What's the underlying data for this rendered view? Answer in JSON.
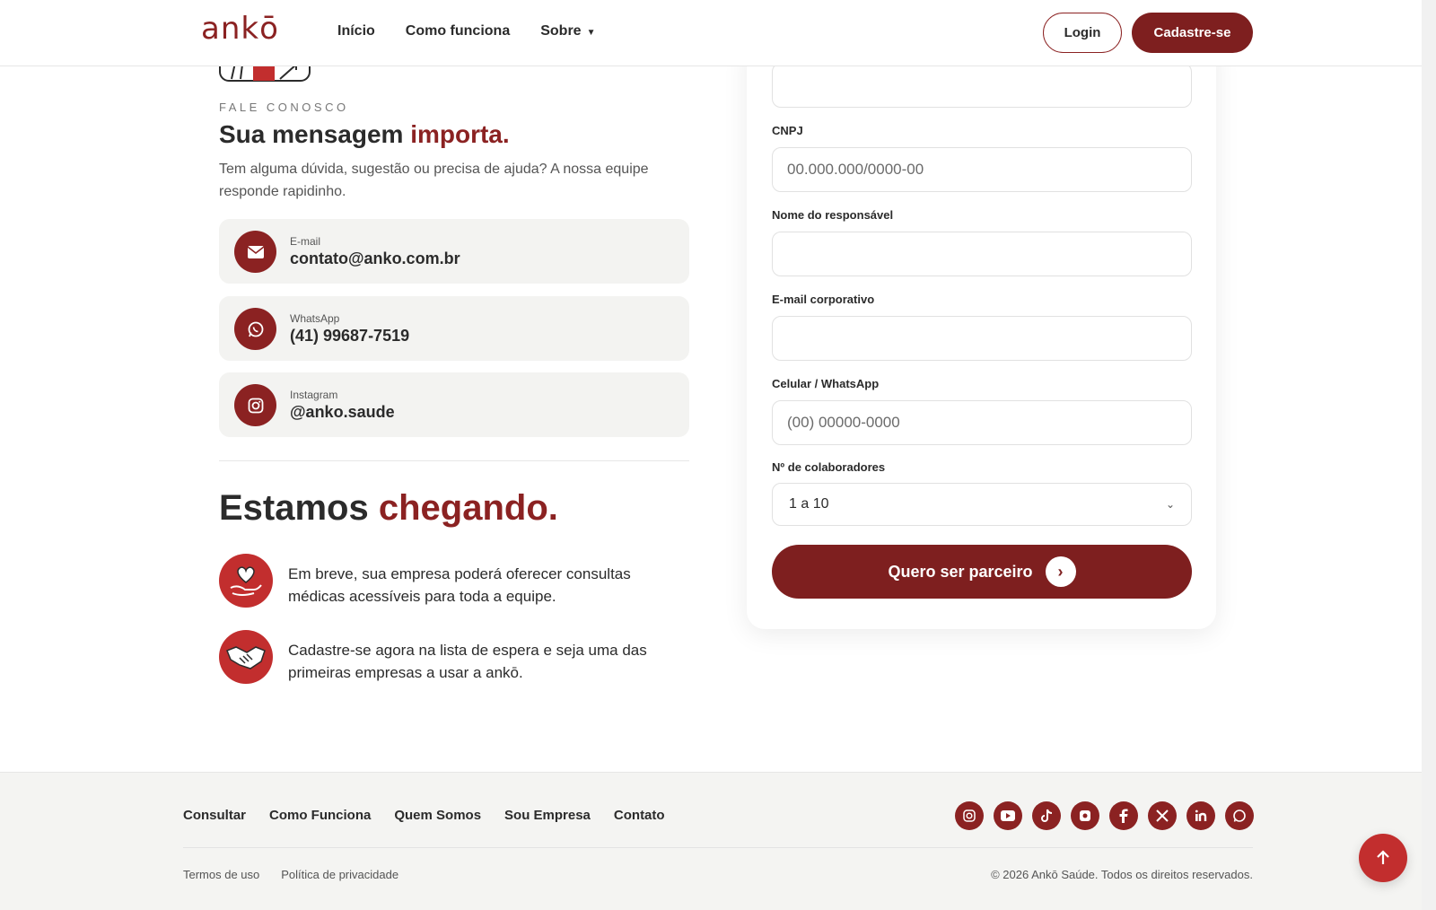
{
  "header": {
    "logo_text": "ankō",
    "nav": [
      "Início",
      "Como funciona",
      "Sobre"
    ],
    "login_label": "Login",
    "signup_label": "Cadastre-se"
  },
  "contact": {
    "eyebrow": "FALE CONOSCO",
    "title_main": "Sua mensagem ",
    "title_accent": "importa.",
    "lead": "Tem alguma dúvida, sugestão ou precisa de ajuda? A nossa equipe responde rapidinho.",
    "items": [
      {
        "label": "E-mail",
        "value": "contato@anko.com.br",
        "icon": "mail-icon"
      },
      {
        "label": "WhatsApp",
        "value": "(41) 99687-7519",
        "icon": "whatsapp-icon"
      },
      {
        "label": "Instagram",
        "value": "@anko.saude",
        "icon": "instagram-icon"
      }
    ]
  },
  "coming": {
    "title_main": "Estamos ",
    "title_accent": "chegando.",
    "features": [
      {
        "text": "Em breve, sua empresa poderá oferecer consultas médicas acessíveis para toda a equipe.",
        "icon": "heart-hand-icon"
      },
      {
        "text": "Cadastre-se agora na lista de espera e seja uma das primeiras empresas a usar a ankō.",
        "icon": "handshake-icon"
      }
    ]
  },
  "form": {
    "fields": [
      {
        "label": "CNPJ",
        "placeholder": "00.000.000/0000-00"
      },
      {
        "label": "Nome do responsável",
        "placeholder": ""
      },
      {
        "label": "E-mail corporativo",
        "placeholder": ""
      },
      {
        "label": "Celular / WhatsApp",
        "placeholder": "(00) 00000-0000"
      }
    ],
    "collaborators_label": "Nº de colaboradores",
    "collaborators_value": "1 a 10",
    "submit_label": "Quero ser parceiro"
  },
  "footer": {
    "nav": [
      "Consultar",
      "Como Funciona",
      "Quem Somos",
      "Sou Empresa",
      "Contato"
    ],
    "social": [
      "instagram-icon",
      "youtube-icon",
      "tiktok-icon",
      "kwai-icon",
      "facebook-icon",
      "x-icon",
      "linkedin-icon",
      "whatsapp-icon"
    ],
    "legal": [
      "Termos de uso",
      "Política de privacidade"
    ],
    "copyright": "© 2026 Ankō Saúde. Todos os direitos reservados."
  },
  "colors": {
    "brand": "#8b2222",
    "brand_dark": "#7e1f1f",
    "accent_red": "#c22e2e"
  }
}
